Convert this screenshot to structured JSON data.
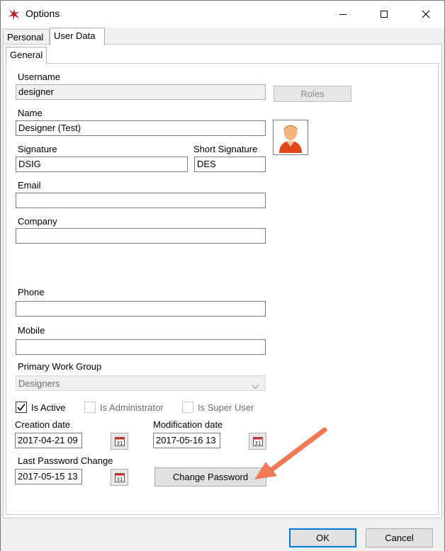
{
  "window": {
    "title": "Options",
    "icons": [
      "app-star-icon",
      "minimize-icon",
      "maximize-icon",
      "close-icon"
    ]
  },
  "tabs": [
    {
      "label": "Personal",
      "active": false
    },
    {
      "label": "User Data",
      "active": true
    }
  ],
  "subtabs": [
    {
      "label": "General",
      "active": true
    }
  ],
  "form": {
    "username": {
      "label": "Username",
      "value": "designer"
    },
    "roles_button": "Roles",
    "name": {
      "label": "Name",
      "value": "Designer (Test)"
    },
    "signature": {
      "label": "Signature",
      "value": "DSIG"
    },
    "short_signature": {
      "label": "Short Signature",
      "value": "DES"
    },
    "email": {
      "label": "Email",
      "value": ""
    },
    "company": {
      "label": "Company",
      "value": ""
    },
    "phone": {
      "label": "Phone",
      "value": ""
    },
    "mobile": {
      "label": "Mobile",
      "value": ""
    },
    "primary_work_group": {
      "label": "Primary Work Group",
      "value": "Designers"
    },
    "is_active": {
      "label": "Is Active",
      "checked": true
    },
    "is_administrator": {
      "label": "Is Administrator",
      "checked": false
    },
    "is_super_user": {
      "label": "Is Super User",
      "checked": false
    },
    "creation_date": {
      "label": "Creation date",
      "value": "2017-04-21 09"
    },
    "modification_date": {
      "label": "Modification date",
      "value": "2017-05-16 13"
    },
    "last_password_change": {
      "label": "Last Password Change",
      "value": "2017-05-15 13"
    },
    "calendar_day": "31",
    "change_password_button": "Change Password"
  },
  "footer": {
    "ok": "OK",
    "cancel": "Cancel"
  },
  "colors": {
    "accent": "#0078d7",
    "arrow": "#f07a56",
    "app_icon": "#b5202a"
  }
}
